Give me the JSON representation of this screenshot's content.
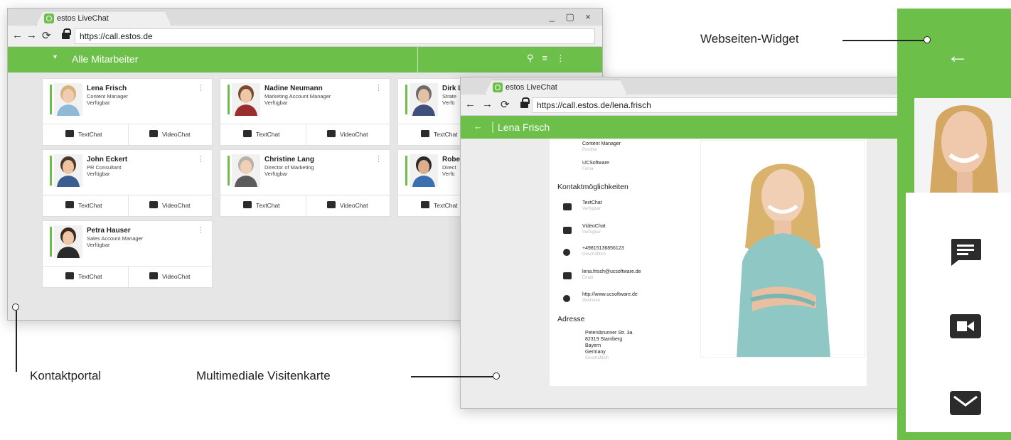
{
  "colors": {
    "accent": "#6cc04a",
    "content_bg": "#e6e6e6",
    "icon_dark": "#2b2b2b"
  },
  "portal": {
    "tab_title": "estos LiveChat",
    "window_controls": "_ ▢ ×",
    "url": "https://call.estos.de",
    "header_title": "Alle Mitarbeiter",
    "cards": [
      {
        "name": "Lena Frisch",
        "role": "Content Manager",
        "status": "Verfügbar",
        "chat_label": "TextChat",
        "video_label": "VideoChat"
      },
      {
        "name": "Nadine Neumann",
        "role": "Marketing Account Manager",
        "status": "Verfügbar",
        "chat_label": "TextChat",
        "video_label": "VideoChat"
      },
      {
        "name": "Dirk L",
        "role": "Strate",
        "status": "Verfü",
        "chat_label": "TextChat",
        "video_label": "VideoChat"
      },
      {
        "name": "John Eckert",
        "role": "PR Consultant",
        "status": "Verfügbar",
        "chat_label": "TextChat",
        "video_label": "VideoChat"
      },
      {
        "name": "Christine Lang",
        "role": "Director of Marketing",
        "status": "Verfügbar",
        "chat_label": "TextChat",
        "video_label": "VideoChat"
      },
      {
        "name": "Robe",
        "role": "Direct",
        "status": "Verfü",
        "chat_label": "TextChat",
        "video_label": "VideoChat"
      },
      {
        "name": "Petra Hauser",
        "role": "Sales Account Manager",
        "status": "Verfügbar",
        "chat_label": "TextChat",
        "video_label": "VideoChat"
      }
    ]
  },
  "card_view": {
    "tab_title": "estos LiveChat",
    "url": "https://call.estos.de/lena.frisch",
    "header_title": "Lena Frisch",
    "position_value": "Content Manager",
    "position_label": "Position",
    "company_value": "UCSoftware",
    "company_label": "Firma",
    "contact_heading": "Kontaktmöglichkeiten",
    "contacts": [
      {
        "value": "TextChat",
        "label": "Verfügbar",
        "icon": "chat-icon"
      },
      {
        "value": "VideoChat",
        "label": "Verfügbar",
        "icon": "video-icon"
      },
      {
        "value": "+49815136856123",
        "label": "Geschäftlich",
        "icon": "phone-icon"
      },
      {
        "value": "lena.frisch@ucsoftware.de",
        "label": "Email",
        "icon": "mail-icon"
      },
      {
        "value": "http://www.ucsoftware.de",
        "label": "Webseite",
        "icon": "globe-icon"
      }
    ],
    "address_heading": "Adresse",
    "address_lines": [
      "Petersbrunner Str. 3a",
      "82319 Starnberg",
      "Bayern",
      "Germany"
    ],
    "address_label": "Geschäftlich"
  },
  "widget": {
    "icons": [
      "back-arrow-icon",
      "chat-icon",
      "video-icon",
      "mail-icon"
    ]
  },
  "callouts": {
    "widget": "Webseiten-Widget",
    "portal": "Kontaktportal",
    "card": "Multimediale Visitenkarte"
  }
}
